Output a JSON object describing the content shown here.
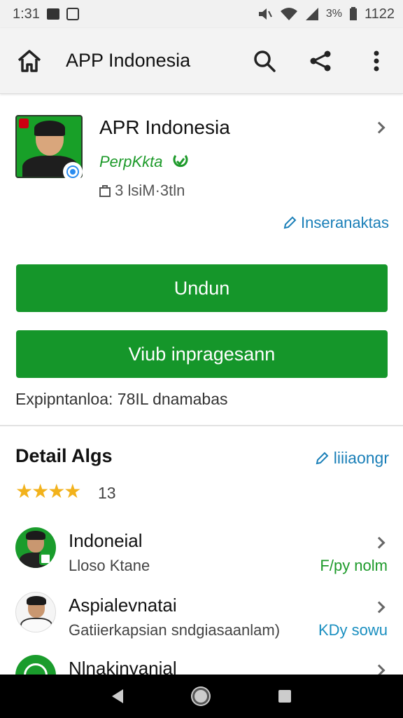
{
  "status_bar": {
    "time": "1:31",
    "battery": "3%",
    "clock_right": "1122"
  },
  "app_bar": {
    "title": "APP Indonesia"
  },
  "app": {
    "name": "APR Indonesia",
    "developer": "PerpKkta",
    "meta": "3 lsiM·3tln",
    "link": "Inseranaktas"
  },
  "buttons": {
    "primary": "Undun",
    "secondary": "Viub inpragesann"
  },
  "size_text": "Expipntanloa: 78IL dnamabas",
  "detail": {
    "title": "Detail Algs",
    "link": "liiiaongr",
    "stars": "★★★★",
    "rating_count": "13"
  },
  "items": [
    {
      "title": "Indoneial",
      "subtitle": "Lloso Ktane",
      "action": "F/py nolm"
    },
    {
      "title": "Aspialevnatai",
      "subtitle": "Gatiierkapsian sndgiasaanlam)",
      "action": "KDy sowu"
    },
    {
      "title": "Nlnakinvanial",
      "subtitle": "",
      "action": ""
    }
  ],
  "colors": {
    "accent": "#15962a",
    "link": "#1a7fb8",
    "star": "#f2b21c"
  }
}
